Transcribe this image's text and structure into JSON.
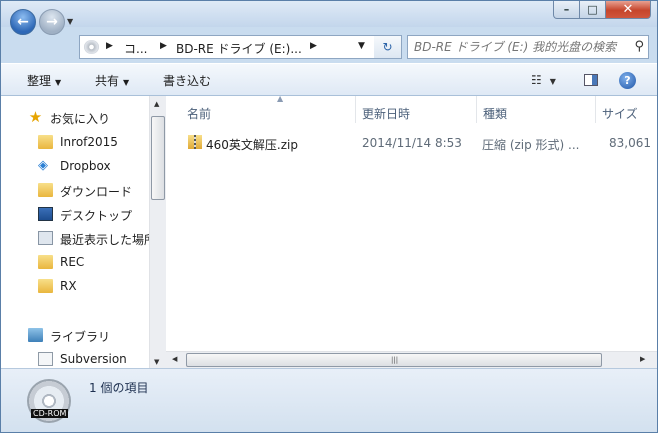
{
  "window": {
    "minimize": "–",
    "maximize": "□",
    "close": "✕"
  },
  "nav": {
    "back_glyph": "←",
    "forward_glyph": "→",
    "breadcrumbs": [
      "コ...",
      "BD-RE ドライブ (E:)..."
    ],
    "refresh_glyph": "↻",
    "search_placeholder": "BD-RE ドライブ (E:) 我的光盘の検索"
  },
  "toolbar": {
    "organize": "整理",
    "share": "共有",
    "burn": "書き込む",
    "help": "?"
  },
  "sidebar": {
    "favorites": "お気に入り",
    "items": [
      "Inrof2015",
      "Dropbox",
      "ダウンロード",
      "デスクトップ",
      "最近表示した場所",
      "REC",
      "RX"
    ],
    "libraries": "ライブラリ",
    "lib_items": [
      "Subversion"
    ]
  },
  "columns": {
    "name": "名前",
    "date": "更新日時",
    "type": "種類",
    "size": "サイズ"
  },
  "files": [
    {
      "name": "460英文解压.zip",
      "date": "2014/11/14 8:53",
      "type": "圧縮 (zip 形式) ...",
      "size": "83,061"
    }
  ],
  "details": {
    "drive_label": "CD-ROM",
    "item_count": "1 個の項目"
  },
  "colors": {
    "accent": "#2d67b6",
    "chrome": "#c9dcef",
    "close": "#c6452c"
  }
}
